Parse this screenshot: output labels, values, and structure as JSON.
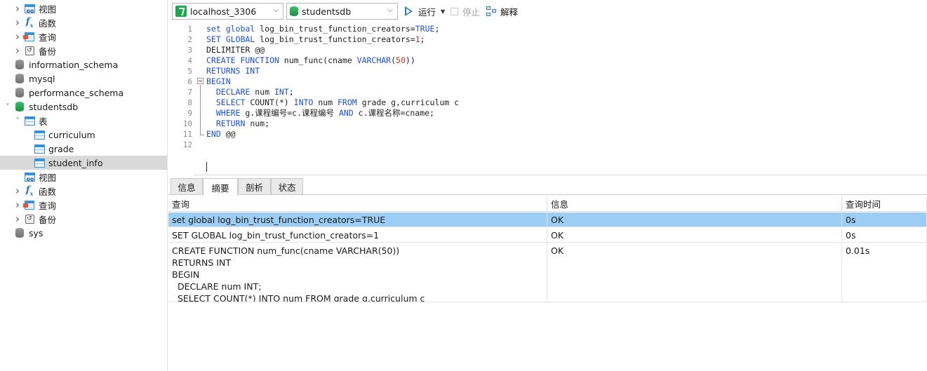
{
  "sidebar": {
    "items": [
      {
        "label": "视图",
        "icon": "view-icon",
        "indent": 1,
        "expander": "collapsed"
      },
      {
        "label": "函数",
        "icon": "function-icon",
        "indent": 1,
        "expander": "collapsed"
      },
      {
        "label": "查询",
        "icon": "query-icon",
        "indent": 1,
        "expander": "collapsed"
      },
      {
        "label": "备份",
        "icon": "backup-icon",
        "indent": 1,
        "expander": "collapsed"
      },
      {
        "label": "information_schema",
        "icon": "database-icon",
        "indent": 0,
        "expander": "none"
      },
      {
        "label": "mysql",
        "icon": "database-icon",
        "indent": 0,
        "expander": "none"
      },
      {
        "label": "performance_schema",
        "icon": "database-icon",
        "indent": 0,
        "expander": "none"
      },
      {
        "label": "studentsdb",
        "icon": "database-icon-green",
        "indent": 0,
        "expander": "expanded"
      },
      {
        "label": "表",
        "icon": "table-folder-icon",
        "indent": 1,
        "expander": "expanded"
      },
      {
        "label": "curriculum",
        "icon": "table-icon",
        "indent": 2,
        "expander": "none"
      },
      {
        "label": "grade",
        "icon": "table-icon",
        "indent": 2,
        "expander": "none"
      },
      {
        "label": "student_info",
        "icon": "table-icon",
        "indent": 2,
        "expander": "none",
        "selected": true
      },
      {
        "label": "视图",
        "icon": "view-icon",
        "indent": 1,
        "expander": "none"
      },
      {
        "label": "函数",
        "icon": "function-icon",
        "indent": 1,
        "expander": "collapsed"
      },
      {
        "label": "查询",
        "icon": "query-icon",
        "indent": 1,
        "expander": "collapsed"
      },
      {
        "label": "备份",
        "icon": "backup-icon",
        "indent": 1,
        "expander": "collapsed"
      },
      {
        "label": "sys",
        "icon": "database-icon",
        "indent": 0,
        "expander": "none"
      }
    ]
  },
  "toolbar": {
    "connection": "localhost_3306",
    "database": "studentsdb",
    "run_label": "运行",
    "stop_label": "停止",
    "explain_label": "解释"
  },
  "editor": {
    "line_numbers": [
      "1",
      "2",
      "3",
      "4",
      "5",
      "6",
      "7",
      "8",
      "9",
      "10",
      "11",
      "12"
    ],
    "lines": [
      [
        {
          "t": "set global ",
          "c": "kw"
        },
        {
          "t": "log_bin_trust_function_creators=",
          "c": ""
        },
        {
          "t": "TRUE",
          "c": "kw"
        },
        {
          "t": ";",
          "c": ""
        }
      ],
      [
        {
          "t": "SET GLOBAL ",
          "c": "kw"
        },
        {
          "t": "log_bin_trust_function_creators=",
          "c": ""
        },
        {
          "t": "1",
          "c": "num"
        },
        {
          "t": ";",
          "c": ""
        }
      ],
      [
        {
          "t": "DELIMITER @@",
          "c": ""
        }
      ],
      [
        {
          "t": "CREATE FUNCTION ",
          "c": "kw"
        },
        {
          "t": "num_func(cname ",
          "c": ""
        },
        {
          "t": "VARCHAR",
          "c": "kw"
        },
        {
          "t": "(",
          "c": ""
        },
        {
          "t": "50",
          "c": "num"
        },
        {
          "t": "))",
          "c": ""
        }
      ],
      [
        {
          "t": "RETURNS INT",
          "c": "kw"
        }
      ],
      [
        {
          "t": "BEGIN",
          "c": "kw"
        }
      ],
      [
        {
          "t": "  ",
          "c": ""
        },
        {
          "t": "DECLARE ",
          "c": "kw"
        },
        {
          "t": "num ",
          "c": ""
        },
        {
          "t": "INT",
          "c": "kw"
        },
        {
          "t": ";",
          "c": ""
        }
      ],
      [
        {
          "t": "  ",
          "c": ""
        },
        {
          "t": "SELECT ",
          "c": "kw"
        },
        {
          "t": "COUNT(*) ",
          "c": ""
        },
        {
          "t": "INTO ",
          "c": "kw"
        },
        {
          "t": "num ",
          "c": ""
        },
        {
          "t": "FROM ",
          "c": "kw"
        },
        {
          "t": "grade g,curriculum c",
          "c": ""
        }
      ],
      [
        {
          "t": "  ",
          "c": ""
        },
        {
          "t": "WHERE ",
          "c": "kw"
        },
        {
          "t": "g.课程编号=c.课程编号 ",
          "c": ""
        },
        {
          "t": "AND ",
          "c": "kw"
        },
        {
          "t": "c.课程名称=cname;",
          "c": ""
        }
      ],
      [
        {
          "t": "  ",
          "c": ""
        },
        {
          "t": "RETURN ",
          "c": "kw"
        },
        {
          "t": "num;",
          "c": ""
        }
      ],
      [
        {
          "t": "END ",
          "c": "kw"
        },
        {
          "t": "@@",
          "c": ""
        }
      ],
      []
    ]
  },
  "result_tabs": [
    "信息",
    "摘要",
    "剖析",
    "状态"
  ],
  "active_tab": "摘要",
  "results": {
    "columns": [
      "查询",
      "信息",
      "查询时间"
    ],
    "rows": [
      {
        "query": "set global log_bin_trust_function_creators=TRUE",
        "info": "OK",
        "time": "0s",
        "selected": true
      },
      {
        "query": "SET GLOBAL log_bin_trust_function_creators=1",
        "info": "OK",
        "time": "0s"
      },
      {
        "query": "CREATE FUNCTION num_func(cname VARCHAR(50))\nRETURNS INT\nBEGIN\n  DECLARE num INT;\n  SELECT COUNT(*) INTO num FROM grade g,curriculum c",
        "info": "OK",
        "time": "0.01s"
      }
    ]
  },
  "colors": {
    "keyword": "#1d4fd1",
    "number": "#d0311c",
    "selection": "#9ccdf5",
    "tree_selected": "#d9d9d9"
  }
}
